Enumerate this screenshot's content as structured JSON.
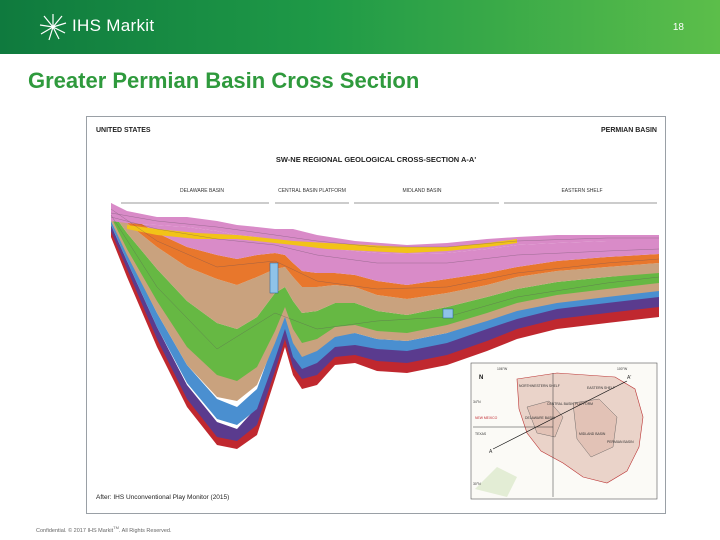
{
  "header": {
    "brand": "IHS Markit",
    "page_number": "18"
  },
  "slide": {
    "title": "Greater Permian Basin Cross Section"
  },
  "figure": {
    "label_left": "UNITED STATES",
    "label_right": "PERMIAN BASIN",
    "title": "SW-NE REGIONAL GEOLOGICAL CROSS-SECTION A-A'",
    "regions": [
      "DELAWARE BASIN",
      "CENTRAL BASIN PLATFORM",
      "MIDLAND BASIN",
      "EASTERN SHELF"
    ],
    "credit": "After: IHS Unconventional Play Monitor (2015)",
    "inset_map": {
      "labels": [
        "NORTHWESTERN SHELF",
        "EASTERN SHELF",
        "DELAWARE BASIN",
        "MIDLAND BASIN",
        "CENTRAL BASIN PLATFORM",
        "NEW MEXICO",
        "TEXAS",
        "PERMIAN BASIN",
        "A",
        "A'"
      ],
      "coords": [
        "106°W",
        "100°W",
        "34°N",
        "30°N"
      ]
    }
  },
  "footer": {
    "text": "Confidential. © 2017 IHS Markit",
    "tm": "TM",
    "suffix": ". All Rights Reserved."
  },
  "colors": {
    "brand_green": "#2f9a3d",
    "layer_yellow": "#f2c318",
    "layer_pink": "#d98bc8",
    "layer_orange": "#e8772c",
    "layer_green": "#66b843",
    "layer_tan": "#c9a27e",
    "layer_blue": "#4a8fd0",
    "layer_purple": "#5a3b8e",
    "layer_red": "#c0282f"
  }
}
